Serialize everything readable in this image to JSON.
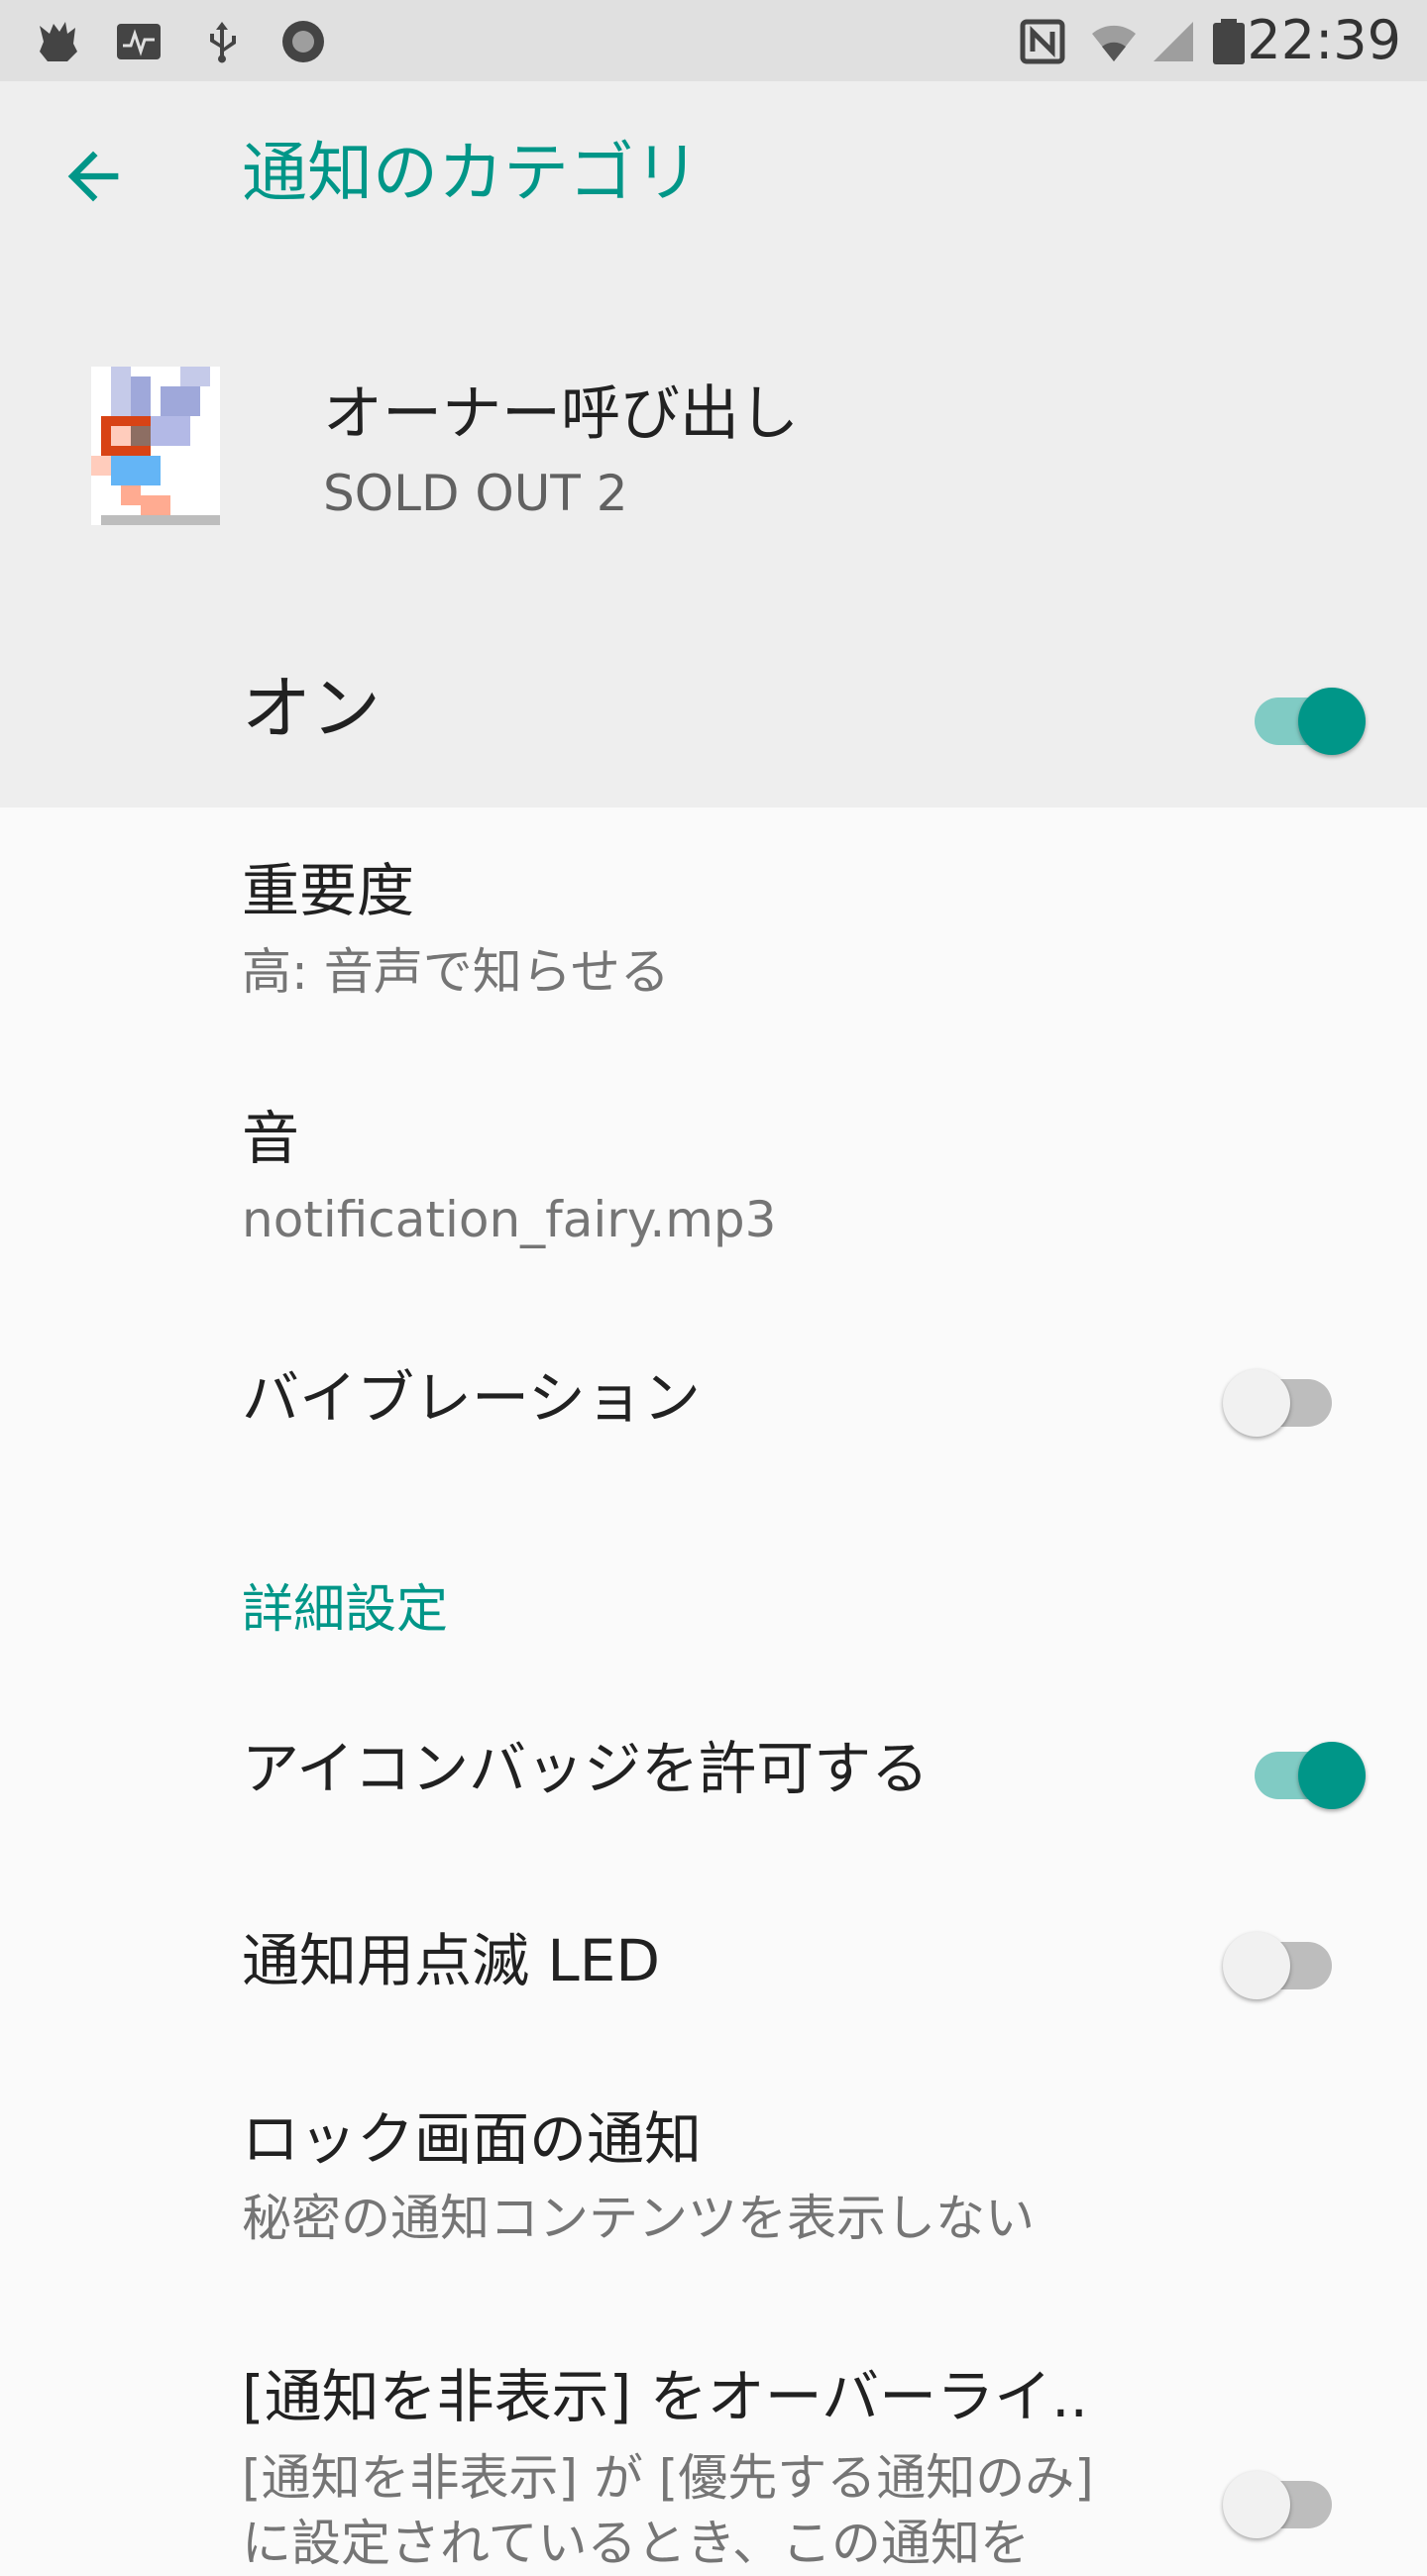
{
  "status_bar": {
    "time": "22:39",
    "left_icons": [
      "app-notification-icon",
      "activity-monitor-icon",
      "usb-icon",
      "circle-notification-icon"
    ],
    "right_icons": [
      "nfc-icon",
      "wifi-icon",
      "cell-signal-icon",
      "battery-icon"
    ]
  },
  "app_bar": {
    "title": "通知のカテゴリ",
    "back_icon": "arrow-back-icon"
  },
  "channel_header": {
    "channel_name": "オーナー呼び出し",
    "app_name": "SOLD OUT 2"
  },
  "master_switch": {
    "label": "オン",
    "checked": true
  },
  "settings": {
    "importance": {
      "title": "重要度",
      "summary": "高: 音声で知らせる"
    },
    "sound": {
      "title": "音",
      "summary": "notification_fairy.mp3"
    },
    "vibration": {
      "title": "バイブレーション",
      "checked": false
    }
  },
  "advanced": {
    "header": "詳細設定",
    "badge": {
      "title": "アイコンバッジを許可する",
      "checked": true
    },
    "blink_light": {
      "title": "通知用点滅 LED",
      "checked": false
    },
    "lock_screen": {
      "title": "ロック画面の通知",
      "summary": "秘密の通知コンテンツを表示しない"
    },
    "dnd_override": {
      "title": "[通知を非表示] をオーバーライ..",
      "summary_line1": "[通知を非表示] が [優先する通知のみ]",
      "summary_line2": "に設定されているとき、この通知を",
      "checked": false
    }
  },
  "colors": {
    "accent": "#009688",
    "accent_track": "#80cbc4",
    "header_bg": "#eeeeee",
    "body_bg": "#fafafa",
    "status_bar_bg": "#e0e0e0"
  }
}
